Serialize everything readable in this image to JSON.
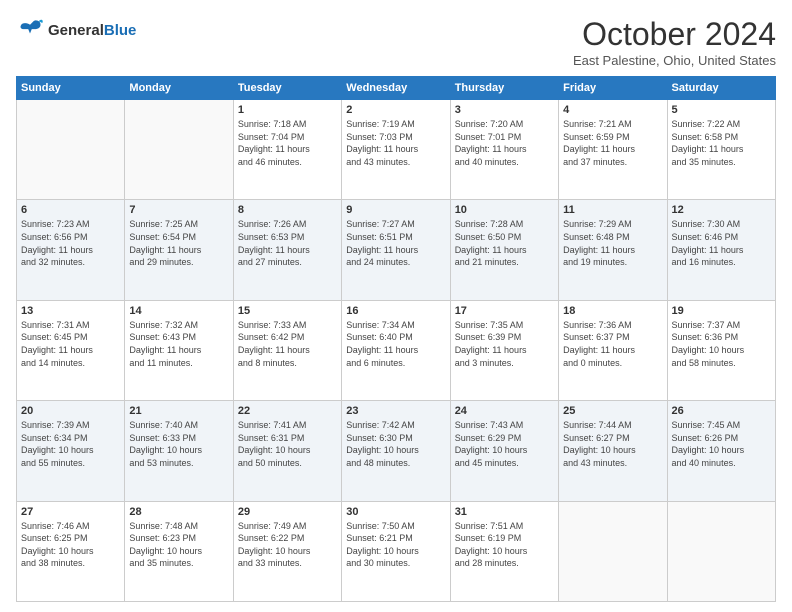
{
  "logo": {
    "line1": "General",
    "line2": "Blue"
  },
  "title": "October 2024",
  "location": "East Palestine, Ohio, United States",
  "days_header": [
    "Sunday",
    "Monday",
    "Tuesday",
    "Wednesday",
    "Thursday",
    "Friday",
    "Saturday"
  ],
  "weeks": [
    [
      {
        "day": "",
        "info": ""
      },
      {
        "day": "",
        "info": ""
      },
      {
        "day": "1",
        "info": "Sunrise: 7:18 AM\nSunset: 7:04 PM\nDaylight: 11 hours\nand 46 minutes."
      },
      {
        "day": "2",
        "info": "Sunrise: 7:19 AM\nSunset: 7:03 PM\nDaylight: 11 hours\nand 43 minutes."
      },
      {
        "day": "3",
        "info": "Sunrise: 7:20 AM\nSunset: 7:01 PM\nDaylight: 11 hours\nand 40 minutes."
      },
      {
        "day": "4",
        "info": "Sunrise: 7:21 AM\nSunset: 6:59 PM\nDaylight: 11 hours\nand 37 minutes."
      },
      {
        "day": "5",
        "info": "Sunrise: 7:22 AM\nSunset: 6:58 PM\nDaylight: 11 hours\nand 35 minutes."
      }
    ],
    [
      {
        "day": "6",
        "info": "Sunrise: 7:23 AM\nSunset: 6:56 PM\nDaylight: 11 hours\nand 32 minutes."
      },
      {
        "day": "7",
        "info": "Sunrise: 7:25 AM\nSunset: 6:54 PM\nDaylight: 11 hours\nand 29 minutes."
      },
      {
        "day": "8",
        "info": "Sunrise: 7:26 AM\nSunset: 6:53 PM\nDaylight: 11 hours\nand 27 minutes."
      },
      {
        "day": "9",
        "info": "Sunrise: 7:27 AM\nSunset: 6:51 PM\nDaylight: 11 hours\nand 24 minutes."
      },
      {
        "day": "10",
        "info": "Sunrise: 7:28 AM\nSunset: 6:50 PM\nDaylight: 11 hours\nand 21 minutes."
      },
      {
        "day": "11",
        "info": "Sunrise: 7:29 AM\nSunset: 6:48 PM\nDaylight: 11 hours\nand 19 minutes."
      },
      {
        "day": "12",
        "info": "Sunrise: 7:30 AM\nSunset: 6:46 PM\nDaylight: 11 hours\nand 16 minutes."
      }
    ],
    [
      {
        "day": "13",
        "info": "Sunrise: 7:31 AM\nSunset: 6:45 PM\nDaylight: 11 hours\nand 14 minutes."
      },
      {
        "day": "14",
        "info": "Sunrise: 7:32 AM\nSunset: 6:43 PM\nDaylight: 11 hours\nand 11 minutes."
      },
      {
        "day": "15",
        "info": "Sunrise: 7:33 AM\nSunset: 6:42 PM\nDaylight: 11 hours\nand 8 minutes."
      },
      {
        "day": "16",
        "info": "Sunrise: 7:34 AM\nSunset: 6:40 PM\nDaylight: 11 hours\nand 6 minutes."
      },
      {
        "day": "17",
        "info": "Sunrise: 7:35 AM\nSunset: 6:39 PM\nDaylight: 11 hours\nand 3 minutes."
      },
      {
        "day": "18",
        "info": "Sunrise: 7:36 AM\nSunset: 6:37 PM\nDaylight: 11 hours\nand 0 minutes."
      },
      {
        "day": "19",
        "info": "Sunrise: 7:37 AM\nSunset: 6:36 PM\nDaylight: 10 hours\nand 58 minutes."
      }
    ],
    [
      {
        "day": "20",
        "info": "Sunrise: 7:39 AM\nSunset: 6:34 PM\nDaylight: 10 hours\nand 55 minutes."
      },
      {
        "day": "21",
        "info": "Sunrise: 7:40 AM\nSunset: 6:33 PM\nDaylight: 10 hours\nand 53 minutes."
      },
      {
        "day": "22",
        "info": "Sunrise: 7:41 AM\nSunset: 6:31 PM\nDaylight: 10 hours\nand 50 minutes."
      },
      {
        "day": "23",
        "info": "Sunrise: 7:42 AM\nSunset: 6:30 PM\nDaylight: 10 hours\nand 48 minutes."
      },
      {
        "day": "24",
        "info": "Sunrise: 7:43 AM\nSunset: 6:29 PM\nDaylight: 10 hours\nand 45 minutes."
      },
      {
        "day": "25",
        "info": "Sunrise: 7:44 AM\nSunset: 6:27 PM\nDaylight: 10 hours\nand 43 minutes."
      },
      {
        "day": "26",
        "info": "Sunrise: 7:45 AM\nSunset: 6:26 PM\nDaylight: 10 hours\nand 40 minutes."
      }
    ],
    [
      {
        "day": "27",
        "info": "Sunrise: 7:46 AM\nSunset: 6:25 PM\nDaylight: 10 hours\nand 38 minutes."
      },
      {
        "day": "28",
        "info": "Sunrise: 7:48 AM\nSunset: 6:23 PM\nDaylight: 10 hours\nand 35 minutes."
      },
      {
        "day": "29",
        "info": "Sunrise: 7:49 AM\nSunset: 6:22 PM\nDaylight: 10 hours\nand 33 minutes."
      },
      {
        "day": "30",
        "info": "Sunrise: 7:50 AM\nSunset: 6:21 PM\nDaylight: 10 hours\nand 30 minutes."
      },
      {
        "day": "31",
        "info": "Sunrise: 7:51 AM\nSunset: 6:19 PM\nDaylight: 10 hours\nand 28 minutes."
      },
      {
        "day": "",
        "info": ""
      },
      {
        "day": "",
        "info": ""
      }
    ]
  ]
}
